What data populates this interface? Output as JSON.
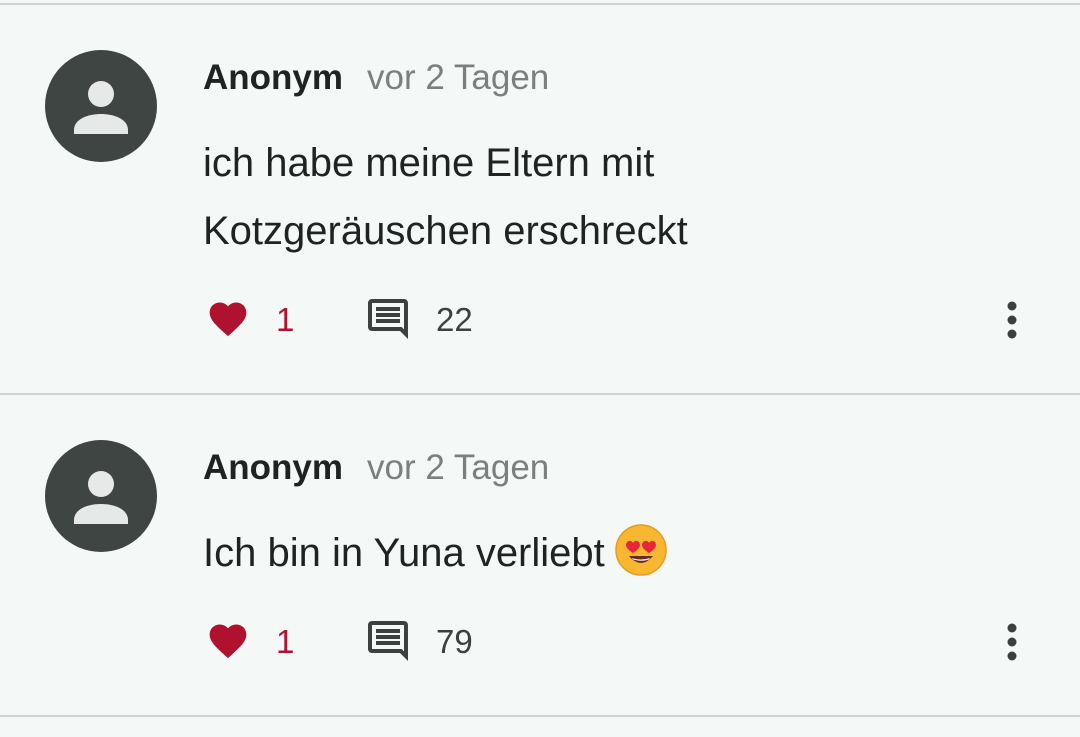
{
  "comments": [
    {
      "author": "Anonym",
      "time": "vor 2 Tagen",
      "text_lines": [
        "ich habe meine Eltern mit",
        "Kotzgeräuschen erschreckt"
      ],
      "likes": "1",
      "replies": "22",
      "avatar_icon": "person-icon"
    },
    {
      "author": "Anonym",
      "time": "vor 2 Tagen",
      "text": "Ich bin in Yuna verliebt",
      "emoji_icon": "heart-eyes-emoji-icon",
      "likes": "1",
      "replies": "79",
      "avatar_icon": "person-icon"
    }
  ],
  "colors": {
    "background": "#f4f8f7",
    "avatar": "#3f4543",
    "like_red": "#b0112f",
    "divider": "#cfd3d2"
  }
}
